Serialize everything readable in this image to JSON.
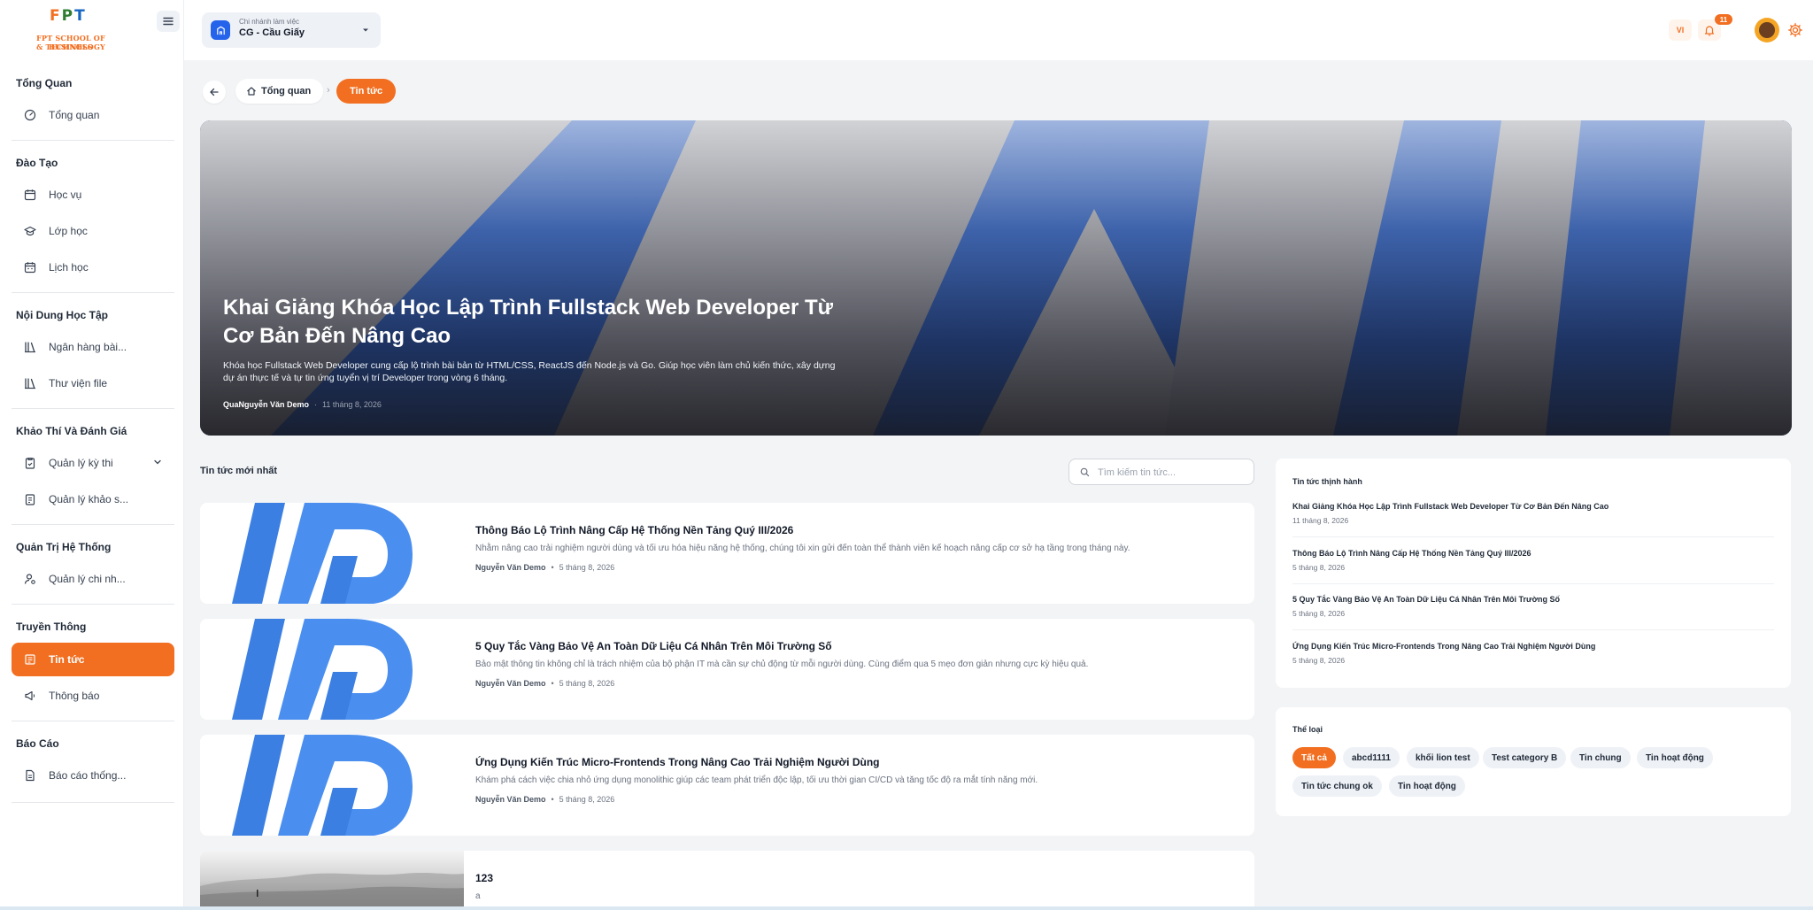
{
  "brand": {
    "logo_letters": [
      "F",
      "P",
      "T"
    ],
    "logo_line1": "FPT SCHOOL OF BUSINESS",
    "logo_line2": "& TECHNOLOGY",
    "accent": "#f26f21",
    "blue": "#2563eb"
  },
  "sidebar": {
    "groups": [
      {
        "title": "Tổng Quan",
        "items": [
          {
            "label": "Tổng quan",
            "icon": "dashboard-icon"
          }
        ]
      },
      {
        "title": "Đào Tạo",
        "items": [
          {
            "label": "Học vụ",
            "icon": "calendar-edit-icon"
          },
          {
            "label": "Lớp học",
            "icon": "graduation-cap-icon"
          },
          {
            "label": "Lịch học",
            "icon": "calendar-icon"
          }
        ]
      },
      {
        "title": "Nội Dung Học Tập",
        "items": [
          {
            "label": "Ngân hàng bài...",
            "icon": "library-icon"
          },
          {
            "label": "Thư viện file",
            "icon": "books-icon"
          }
        ]
      },
      {
        "title": "Khảo Thí Và Đánh Giá",
        "items": [
          {
            "label": "Quản lý kỳ thi",
            "icon": "clipboard-check-icon"
          },
          {
            "label": "Quản lý khảo s...",
            "icon": "survey-icon"
          }
        ]
      },
      {
        "title": "Quản Trị Hệ Thống",
        "items": [
          {
            "label": "Quản lý chi nh...",
            "icon": "user-settings-icon"
          }
        ]
      },
      {
        "title": "Truyền Thông",
        "items": [
          {
            "label": "Tin tức",
            "icon": "newspaper-icon",
            "active": true
          },
          {
            "label": "Thông báo",
            "icon": "megaphone-icon"
          }
        ]
      },
      {
        "title": "Báo Cáo",
        "items": [
          {
            "label": "Báo cáo thống...",
            "icon": "report-icon"
          }
        ]
      }
    ]
  },
  "header": {
    "branch_label": "Chi nhánh làm việc",
    "branch_value": "CG - Cầu Giấy",
    "language": "VI",
    "notification_count": "11"
  },
  "breadcrumb": {
    "home": "Tổng quan",
    "current": "Tin tức"
  },
  "hero": {
    "title": "Khai Giảng Khóa Học Lập Trình Fullstack Web Developer Từ Cơ Bản Đến Nâng Cao",
    "description": "Khóa học Fullstack Web Developer cung cấp lộ trình bài bản từ HTML/CSS, ReactJS đến Node.js và Go. Giúp học viên làm chủ kiến thức, xây dựng dự án thực tế và tự tin ứng tuyển vị trí Developer trong vòng 6 tháng.",
    "author": "QuaNguyễn Văn Demo",
    "date": "11 tháng 8, 2026"
  },
  "latest": {
    "title": "Tin tức mới nhất",
    "search_placeholder": "Tìm kiếm tin tức...",
    "items": [
      {
        "title": "Thông Báo Lộ Trình Nâng Cấp Hệ Thống Nền Tảng Quý III/2026",
        "description": "Nhằm nâng cao trải nghiệm người dùng và tối ưu hóa hiệu năng hệ thống, chúng tôi xin gửi đến toàn thể thành viên kế hoạch nâng cấp cơ sở hạ tầng trong tháng này.",
        "author": "Nguyễn Văn Demo",
        "date": "5 tháng 8, 2026"
      },
      {
        "title": "5 Quy Tắc Vàng Bảo Vệ An Toàn Dữ Liệu Cá Nhân Trên Môi Trường Số",
        "description": "Bảo mật thông tin không chỉ là trách nhiệm của bộ phận IT mà cần sự chủ động từ mỗi người dùng. Cùng điểm qua 5 mẹo đơn giản nhưng cực kỳ hiệu quả.",
        "author": "Nguyễn Văn Demo",
        "date": "5 tháng 8, 2026"
      },
      {
        "title": "Ứng Dụng Kiến Trúc Micro-Frontends Trong Nâng Cao Trải Nghiệm Người Dùng",
        "description": "Khám phá cách việc chia nhỏ ứng dụng monolithic giúp các team phát triển độc lập, tối ưu thời gian CI/CD và tăng tốc độ ra mắt tính năng mới.",
        "author": "Nguyễn Văn Demo",
        "date": "5 tháng 8, 2026"
      },
      {
        "title": "123",
        "description": "a",
        "author": "",
        "date": ""
      }
    ]
  },
  "trending": {
    "title": "Tin tức thịnh hành",
    "items": [
      {
        "title": "Khai Giảng Khóa Học Lập Trình Fullstack Web Developer Từ Cơ Bản Đến Nâng Cao",
        "date": "11 tháng 8, 2026"
      },
      {
        "title": "Thông Báo Lộ Trình Nâng Cấp Hệ Thống Nền Tảng Quý III/2026",
        "date": "5 tháng 8, 2026"
      },
      {
        "title": "5 Quy Tắc Vàng Bảo Vệ An Toàn Dữ Liệu Cá Nhân Trên Môi Trường Số",
        "date": "5 tháng 8, 2026"
      },
      {
        "title": "Ứng Dụng Kiến Trúc Micro-Frontends Trong Nâng Cao Trải Nghiệm Người Dùng",
        "date": "5 tháng 8, 2026"
      }
    ]
  },
  "categories": {
    "title": "Thể loại",
    "items": [
      "Tất cả",
      "abcd1111",
      "khối lion test",
      "Test category B",
      "Tin chung",
      "Tin hoạt động",
      "Tin tức chung ok",
      "Tin hoạt động"
    ]
  }
}
